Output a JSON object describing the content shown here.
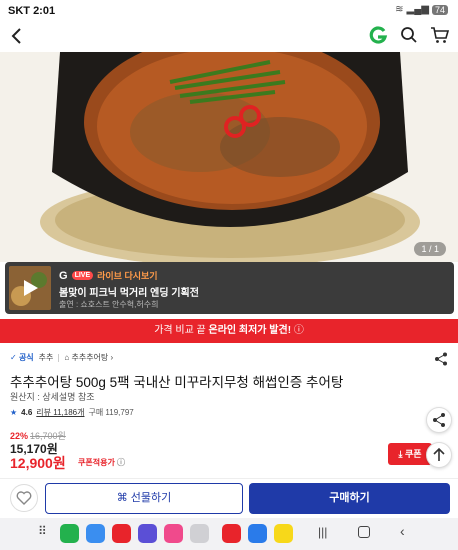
{
  "status_bar": {
    "carrier": "SKT",
    "time": "2:01",
    "battery": "74"
  },
  "header": {
    "brand_logo": "G"
  },
  "hero": {
    "pager": "1 / 1"
  },
  "live": {
    "brand": "G",
    "badge": "LIVE",
    "tag": "라이브 다시보기",
    "title": "봄맞이 피크닉 먹거리 엔딩 기획전",
    "cast": "출연 : 쇼호스트 안수혁,허수희"
  },
  "banner": {
    "prefix": "가격 비교 끝 ",
    "highlight": "온라인 최저가 발견!"
  },
  "product": {
    "official": "공식",
    "seller": "추추",
    "brand_link": "추추추어탕",
    "title": "추추추어탕 500g 5팩 국내산 미꾸라지무청 해썹인증 추어탕",
    "origin": "원산지 : 상세설명 참조",
    "rating": "4.6",
    "reviews": "리뷰 11,186개",
    "purchases": "구매 119,797",
    "discount_pct": "22%",
    "original_price": "16,700원",
    "price": "15,170원",
    "coupon_price": "12,900원",
    "coupon_label": "쿠폰적용가",
    "coupon_button": "쿠폰"
  },
  "actions": {
    "gift": "선물하기",
    "buy": "구매하기"
  },
  "colors": {
    "accent_red": "#e8242b",
    "brand_blue": "#1f3aa8",
    "g_green": "#23b14d"
  }
}
